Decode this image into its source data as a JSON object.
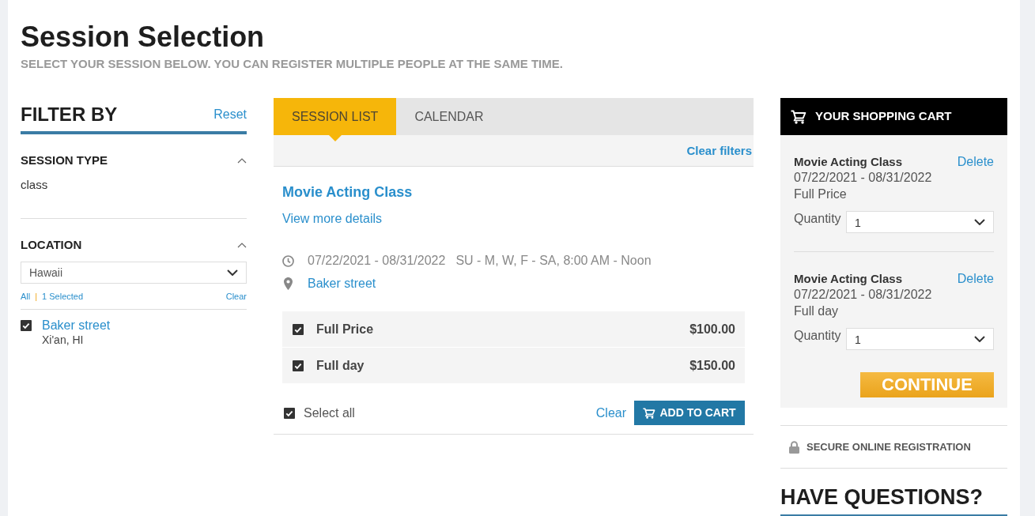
{
  "page": {
    "title": "Session Selection",
    "subtitle": "SELECT YOUR SESSION BELOW. YOU CAN REGISTER MULTIPLE PEOPLE AT THE SAME TIME."
  },
  "filters": {
    "title": "FILTER BY",
    "reset": "Reset",
    "sections": [
      {
        "kind": "text",
        "title": "SESSION TYPE",
        "expanded": true,
        "value": "class"
      },
      {
        "kind": "location",
        "title": "LOCATION",
        "expanded": true,
        "select_value": "Hawaii",
        "all": "All",
        "separator": "|",
        "selected_count": "1 Selected",
        "clear": "Clear",
        "options": [
          {
            "name": "Baker street",
            "address": "Xi'an, HI",
            "checked": true
          }
        ]
      }
    ]
  },
  "tabs": [
    {
      "label": "SESSION LIST",
      "selected": true
    },
    {
      "label": "CALENDAR",
      "selected": false
    }
  ],
  "session_list": {
    "clear_filters": "Clear filters",
    "session": {
      "title": "Movie Acting Class",
      "details_link": "View more details",
      "dates": "07/22/2021 - 08/31/2022",
      "schedule": "SU - M, W, F - SA, 8:00 AM - Noon",
      "location": "Baker street",
      "prices": [
        {
          "name": "Full Price",
          "price": "$100.00",
          "checked": true
        },
        {
          "name": "Full day",
          "price": "$150.00",
          "checked": true
        }
      ],
      "select_all": {
        "label": "Select all",
        "checked": true
      },
      "clear": "Clear",
      "add_to_cart": "ADD TO CART"
    }
  },
  "cart": {
    "title": "YOUR SHOPPING CART",
    "items": [
      {
        "name": "Movie Acting Class",
        "delete": "Delete",
        "dates": "07/22/2021 - 08/31/2022",
        "price_type": "Full Price",
        "quantity_label": "Quantity",
        "quantity": "1"
      },
      {
        "name": "Movie Acting Class",
        "delete": "Delete",
        "dates": "07/22/2021 - 08/31/2022",
        "price_type": "Full day",
        "quantity_label": "Quantity",
        "quantity": "1"
      }
    ],
    "continue": "CONTINUE"
  },
  "secure_note": "SECURE ONLINE REGISTRATION",
  "questions": {
    "title": "HAVE QUESTIONS?"
  }
}
